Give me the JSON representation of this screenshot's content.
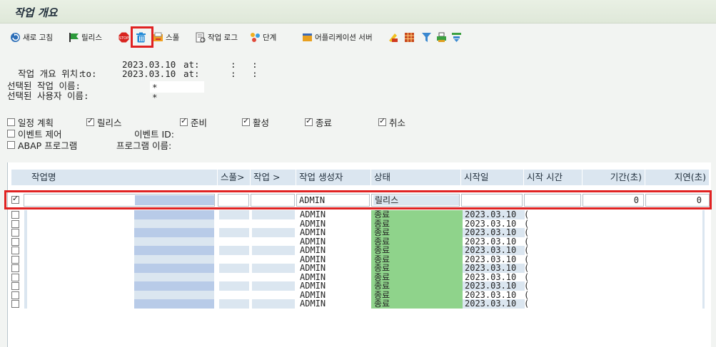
{
  "title": "작업 개요",
  "toolbar": {
    "refresh": "새로 고침",
    "release": "릴리스",
    "stop_icon_text": "STOP",
    "spool": "스풀",
    "job_log": "작업 로그",
    "step": "단계",
    "app_server": "어플리케이션 서버"
  },
  "info": {
    "overview_location_label": "작업 개요 위치:",
    "from_date": "2023.03.10",
    "at1": "at:",
    "time1": ":   :",
    "to_label": "to:",
    "to_date": "2023.03.10",
    "at2": "at:",
    "time2": ":   :",
    "job_name_label": "선택된 작업 이름:",
    "job_name_value": "*",
    "user_name_label": "선택된 사용자 이름:",
    "user_name_value": "*"
  },
  "filters": {
    "scheduled": "일정 계획",
    "released": "릴리스",
    "ready": "준비",
    "active": "활성",
    "finished": "종료",
    "canceled": "취소",
    "event_control": "이벤트 제어",
    "event_id": "이벤트 ID:",
    "abap_program": "ABAP 프로그램",
    "program_name": "프로그램 이름:"
  },
  "table": {
    "headers": [
      "작업명",
      "스풀>",
      "작업 >",
      "작업 생성자",
      "상태",
      "시작일",
      "시작 시간",
      "기간(초)",
      "지연(초)"
    ],
    "selected_row": {
      "creator": "ADMIN",
      "status": "릴리스",
      "duration": "0",
      "delay": "0"
    },
    "rows": [
      {
        "creator": "ADMIN",
        "status": "종료",
        "date": "2023.03.10",
        "time": "("
      },
      {
        "creator": "ADMIN",
        "status": "종료",
        "date": "2023.03.10",
        "time": "("
      },
      {
        "creator": "ADMIN",
        "status": "종료",
        "date": "2023.03.10",
        "time": "("
      },
      {
        "creator": "ADMIN",
        "status": "종료",
        "date": "2023.03.10",
        "time": "("
      },
      {
        "creator": "ADMIN",
        "status": "종료",
        "date": "2023.03.10",
        "time": "("
      },
      {
        "creator": "ADMIN",
        "status": "종료",
        "date": "2023.03.10",
        "time": "("
      },
      {
        "creator": "ADMIN",
        "status": "종료",
        "date": "2023.03.10",
        "time": "("
      },
      {
        "creator": "ADMIN",
        "status": "종료",
        "date": "2023.03.10",
        "time": "("
      },
      {
        "creator": "ADMIN",
        "status": "종료",
        "date": "2023.03.10",
        "time": "("
      },
      {
        "creator": "ADMIN",
        "status": "종료",
        "date": "2023.03.10",
        "time": "("
      },
      {
        "creator": "ADMIN",
        "status": "종료",
        "date": "2023.03.10",
        "time": "("
      }
    ]
  },
  "colors": {
    "highlight": "#e02222",
    "status_green": "#8fd38b",
    "header_blue": "#dbe6f0"
  }
}
